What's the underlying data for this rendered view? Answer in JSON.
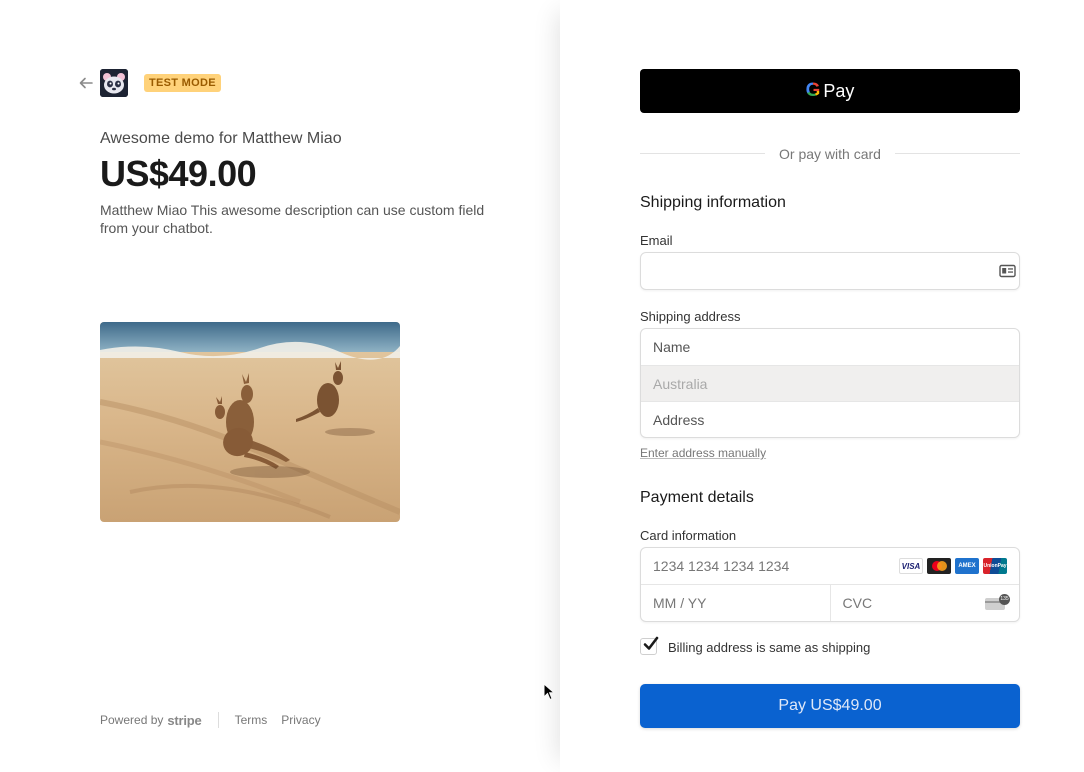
{
  "header": {
    "test_mode_badge": "TEST MODE"
  },
  "product": {
    "name": "Awesome demo for Matthew Miao",
    "price": "US$49.00",
    "description": "Matthew Miao This awesome description can use custom field from your chatbot."
  },
  "footer": {
    "powered_by": "Powered by",
    "brand": "stripe",
    "terms": "Terms",
    "privacy": "Privacy"
  },
  "wallet": {
    "gpay_g": "G",
    "gpay_label": "Pay"
  },
  "divider_text": "Or pay with card",
  "shipping": {
    "title": "Shipping information",
    "email_label": "Email",
    "email_value": "",
    "address_label": "Shipping address",
    "name_placeholder": "Name",
    "country": "Australia",
    "address_placeholder": "Address",
    "manual_link": "Enter address manually"
  },
  "payment": {
    "title": "Payment details",
    "card_label": "Card information",
    "card_number_placeholder": "1234 1234 1234 1234",
    "expiry_placeholder": "MM / YY",
    "cvc_placeholder": "CVC",
    "cvc_badge": "135",
    "brands": [
      {
        "name": "visa-icon",
        "text": "VISA"
      },
      {
        "name": "mastercard-icon",
        "text": ""
      },
      {
        "name": "amex-icon",
        "text": "AMEX"
      },
      {
        "name": "unionpay-icon",
        "text": "UnionPay"
      }
    ],
    "billing_same_label": "Billing address is same as shipping",
    "billing_same_checked": true,
    "pay_button": "Pay US$49.00"
  },
  "colors": {
    "pay_button": "#0a62d0",
    "badge_bg": "#ffd27a",
    "badge_text": "#9a5b00"
  }
}
